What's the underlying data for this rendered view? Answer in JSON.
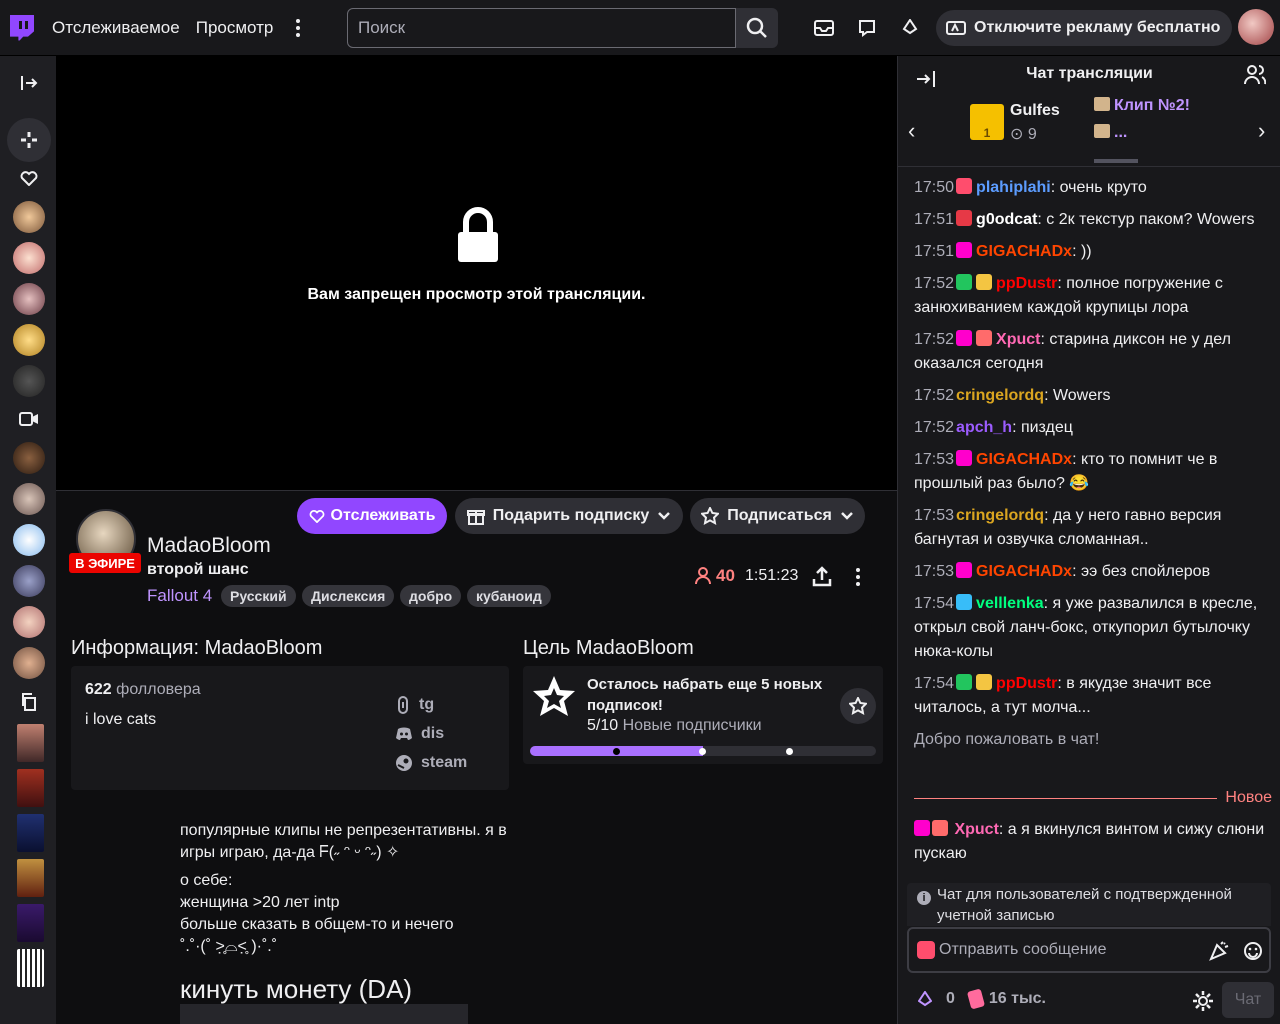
{
  "topbar": {
    "nav_following": "Отслеживаемое",
    "nav_browse": "Просмотр",
    "search_placeholder": "Поиск",
    "ads_button": "Отключите рекламу бесплатно"
  },
  "player": {
    "message": "Вам запрещен просмотр этой трансляции."
  },
  "actions": {
    "follow": "Отслеживать",
    "gift_sub": "Подарить подписку",
    "subscribe": "Подписаться"
  },
  "channel": {
    "live_badge": "В ЭФИРЕ",
    "name": "MadaoBloom",
    "title": "второй шанс",
    "game": "Fallout 4",
    "tags": [
      "Русский",
      "Дислексия",
      "добро",
      "кубаноид"
    ],
    "viewers": "40",
    "uptime": "1:51:23"
  },
  "about": {
    "heading": "Информация: MadaoBloom",
    "followers_count": "622",
    "followers_label": "фолловера",
    "bio": "i love cats",
    "links": [
      "tg",
      "dis",
      "steam"
    ]
  },
  "goal": {
    "heading": "Цель MadaoBloom",
    "title": "Осталось набрать еще 5 новых подписок!",
    "progress_text": "5/10",
    "progress_label": "Новые подписчики",
    "progress_fraction": 0.5
  },
  "description": {
    "line1": "популярные клипы не репрезентативны. я в игры играю, да-да ᖴ(˶ ᵔ ᵕ ᵔ˶) ✧",
    "about_title": "о себе:",
    "about_line1": "женщина >20 лет intp",
    "about_line2": "больше сказать в общем-то и нечего",
    "about_line3": "˚.˚·(˚ ˃̣̣̥⌓˂̣̣̥ )·˚.˚",
    "donate_heading": "кинуть монету (DA)"
  },
  "chat": {
    "header": "Чат трансляции",
    "clip1_name": "Gulfes",
    "clip1_views": "9",
    "clip2_name": "Клип №2!",
    "clip3_name": "...",
    "messages": [
      {
        "time": "17:50",
        "user": "plahiplahi",
        "color": "#5c9cff",
        "text": ": очень круто"
      },
      {
        "time": "17:51",
        "user": "g0odcat",
        "color": "#ffffff",
        "text": ": с 2к текстур паком? Wowers"
      },
      {
        "time": "17:51",
        "user": "GIGACHADx",
        "color": "#ff4500",
        "text": ": ))"
      },
      {
        "time": "17:52",
        "user": "ppDustr",
        "color": "#ff0000",
        "text": ": полное погружение с занюхиванием каждой крупицы лора"
      },
      {
        "time": "17:52",
        "user": "Xpuct",
        "color": "#ff69b4",
        "text": ": старина диксон не у дел оказался сегодня"
      },
      {
        "time": "17:52",
        "user": "cringelordq",
        "color": "#daa520",
        "text": ": Wowers"
      },
      {
        "time": "17:52",
        "user": "apch_h",
        "color": "#9c5cff",
        "text": ": пиздец"
      },
      {
        "time": "17:53",
        "user": "GIGACHADx",
        "color": "#ff4500",
        "text": ": кто то помнит че в прошлый раз было? 😂"
      },
      {
        "time": "17:53",
        "user": "cringelordq",
        "color": "#daa520",
        "text": ": да у него гавно версия багнутая и озвучка сломанная.."
      },
      {
        "time": "17:53",
        "user": "GIGACHADx",
        "color": "#ff4500",
        "text": ": ээ без спойлеров"
      },
      {
        "time": "17:54",
        "user": "velllenka",
        "color": "#00ff7f",
        "text": ": я уже развалился в кресле, открыл свой ланч-бокс, откупорил бутылочку нюка-колы"
      },
      {
        "time": "17:54",
        "user": "ppDustr",
        "color": "#ff0000",
        "text": ": в якудзе значит все читалось, а тут молча..."
      }
    ],
    "welcome": "Добро пожаловать в чат!",
    "new_label": "Новое",
    "last_user": "Xpuct",
    "last_text": ": а я вкинулся винтом и сижу слюни пускаю",
    "verify_note": "Чат для пользователей с подтвержденной учетной записью",
    "input_placeholder": "Отправить сообщение",
    "bits": "0",
    "points": "16 тыс.",
    "chat_button": "Чат"
  },
  "colors": {
    "accent": "#9147ff",
    "live": "#eb0400",
    "viewers": "#ff8280",
    "game": "#bf94ff"
  }
}
